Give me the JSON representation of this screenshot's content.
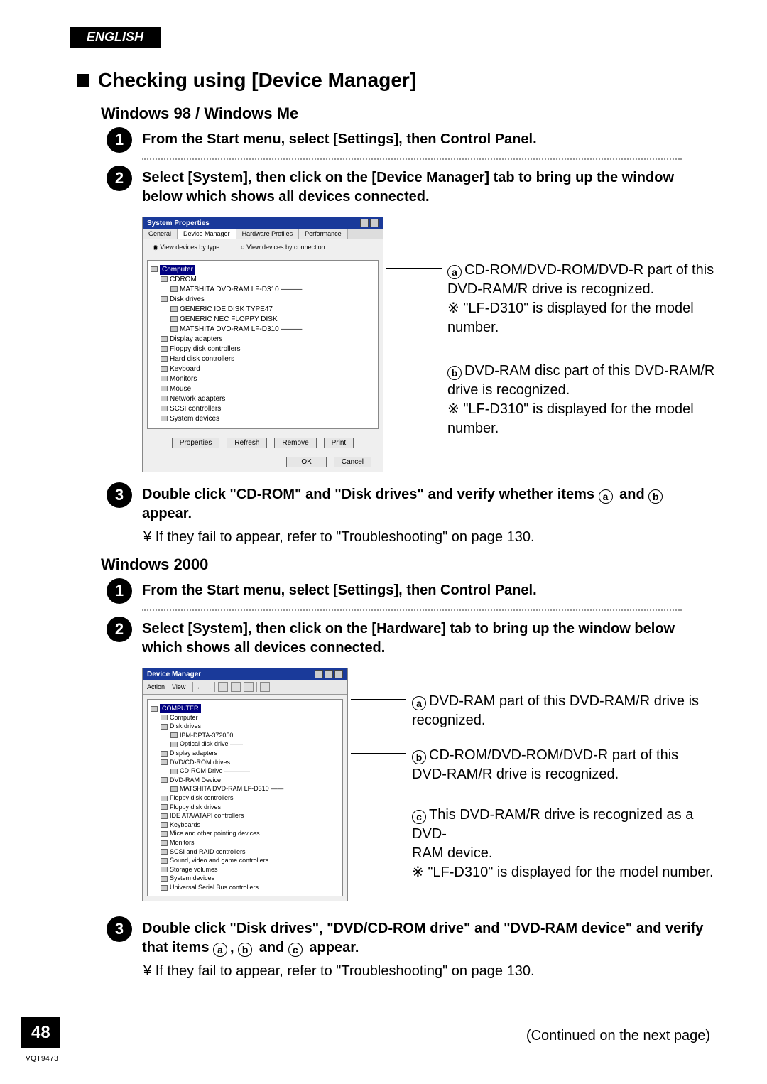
{
  "lang_badge": "ENGLISH",
  "page_number": "48",
  "doc_code": "VQT9473",
  "continued": "(Continued on the next page)",
  "main_heading": "Checking using [Device Manager]",
  "win98me": {
    "heading": "Windows 98 / Windows Me",
    "step1": "From the Start menu, select [Settings], then Control Panel.",
    "step2": "Select [System], then click on the [Device Manager] tab to bring up the window below which shows all devices connected.",
    "step3_pre": "Double click \"CD-ROM\" and \"Disk drives\" and verify whether items ",
    "step3_mid": " and ",
    "step3_post": " appear.",
    "step3_note": "If they fail to appear, refer to \"Troubleshooting\" on page 130.",
    "callout_a_line1": "CD-ROM/DVD-ROM/DVD-R part of this",
    "callout_a_line2": "DVD-RAM/R drive is recognized.",
    "callout_a_note": "\"LF-D310\" is displayed for the model number.",
    "callout_b_line1": "DVD-RAM disc part of this DVD-RAM/R",
    "callout_b_line2": "drive is recognized.",
    "callout_b_note": "\"LF-D310\" is displayed for the model number.",
    "dlg": {
      "title": "System Properties",
      "tabs": [
        "General",
        "Device Manager",
        "Hardware Profiles",
        "Performance"
      ],
      "radio_on": "View devices by type",
      "radio_off": "View devices by connection",
      "root": "Computer",
      "items": [
        "CDROM",
        "MATSHITA DVD-RAM LF-D310",
        "Disk drives",
        "GENERIC IDE  DISK TYPE47",
        "GENERIC NEC  FLOPPY DISK",
        "MATSHITA DVD-RAM LF-D310",
        "Display adapters",
        "Floppy disk controllers",
        "Hard disk controllers",
        "Keyboard",
        "Monitors",
        "Mouse",
        "Network adapters",
        "SCSI controllers",
        "System devices"
      ],
      "buttons": [
        "Properties",
        "Refresh",
        "Remove",
        "Print"
      ],
      "ok": "OK",
      "cancel": "Cancel"
    }
  },
  "win2000": {
    "heading": "Windows 2000",
    "step1": "From the Start menu, select [Settings], then Control Panel.",
    "step2": "Select [System], then click on the [Hardware] tab to bring up the window below which shows all devices connected.",
    "step3_pre": "Double click \"Disk drives\", \"DVD/CD-ROM drive\" and \"DVD-RAM device\" and verify that items ",
    "step3_mid1": ", ",
    "step3_mid2": " and ",
    "step3_post": " appear.",
    "step3_note": "If they fail to appear, refer to \"Troubleshooting\" on page 130.",
    "callout_a_line1": "DVD-RAM part of this DVD-RAM/R drive is",
    "callout_a_line2": "recognized.",
    "callout_b_line1": "CD-ROM/DVD-ROM/DVD-R part of this",
    "callout_b_line2": "DVD-RAM/R drive is recognized.",
    "callout_c_line1": "This DVD-RAM/R drive is recognized as a DVD-",
    "callout_c_line2": "RAM device.",
    "callout_c_note": "\"LF-D310\" is displayed for the model number.",
    "dlg": {
      "title": "Device Manager",
      "menus": [
        "Action",
        "View"
      ],
      "root": "COMPUTER",
      "items": [
        "Computer",
        "Disk drives",
        "IBM-DPTA-372050",
        "Optical disk drive",
        "Display adapters",
        "DVD/CD-ROM drives",
        "CD-ROM Drive",
        "DVD-RAM Device",
        "MATSHITA DVD-RAM LF-D310",
        "Floppy disk controllers",
        "Floppy disk drives",
        "IDE ATA/ATAPI controllers",
        "Keyboards",
        "Mice and other pointing devices",
        "Monitors",
        "SCSI and RAID controllers",
        "Sound, video and game controllers",
        "Storage volumes",
        "System devices",
        "Universal Serial Bus controllers"
      ]
    }
  },
  "letters": {
    "a": "a",
    "b": "b",
    "c": "c"
  },
  "nums": {
    "n1": "1",
    "n2": "2",
    "n3": "3"
  }
}
